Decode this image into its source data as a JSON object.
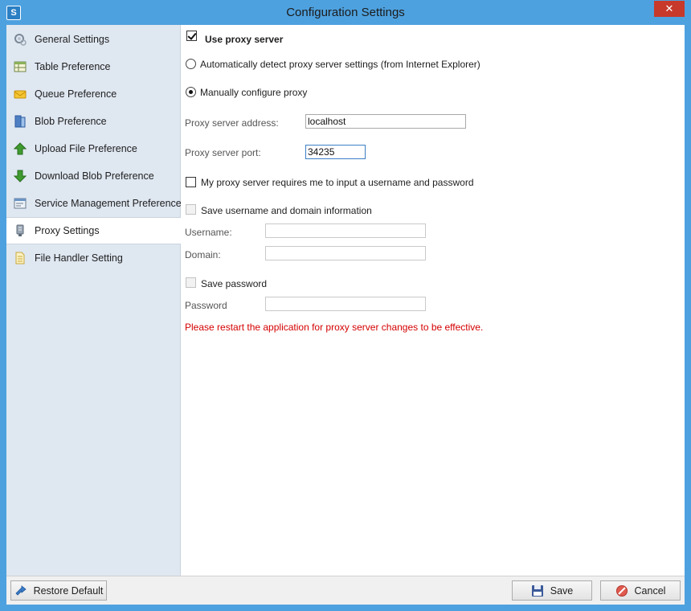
{
  "window": {
    "title": "Configuration Settings",
    "app_icon_text": "S",
    "close_glyph": "✕"
  },
  "sidebar": {
    "items": [
      {
        "label": "General Settings",
        "icon": "gear-icon"
      },
      {
        "label": "Table Preference",
        "icon": "table-icon"
      },
      {
        "label": "Queue Preference",
        "icon": "queue-icon"
      },
      {
        "label": "Blob Preference",
        "icon": "blob-icon"
      },
      {
        "label": "Upload File Preference",
        "icon": "upload-arrow-icon"
      },
      {
        "label": "Download Blob Preference",
        "icon": "download-arrow-icon"
      },
      {
        "label": "Service Management Preference",
        "icon": "service-window-icon"
      },
      {
        "label": "Proxy Settings",
        "icon": "proxy-server-icon",
        "selected": true
      },
      {
        "label": "File Handler Setting",
        "icon": "file-icon"
      }
    ]
  },
  "proxy": {
    "use_proxy_label": "Use proxy server",
    "use_proxy_checked": true,
    "auto_detect_label": "Automatically detect proxy server settings (from Internet Explorer)",
    "manual_label": "Manually configure proxy",
    "mode": "manual",
    "address_label": "Proxy server address:",
    "address_value": "localhost",
    "port_label": "Proxy server port:",
    "port_value": "34235",
    "requires_auth_label": "My proxy server requires me to input a username and password",
    "requires_auth_checked": false,
    "save_user_label": "Save username and domain information",
    "username_label": "Username:",
    "username_value": "",
    "domain_label": "Domain:",
    "domain_value": "",
    "save_password_label": "Save password",
    "password_label": "Password",
    "password_value": "",
    "restart_notice": "Please restart the application for proxy server changes to be effective."
  },
  "footer": {
    "restore_label": "Restore Default",
    "save_label": "Save",
    "cancel_label": "Cancel"
  },
  "colors": {
    "titlebar": "#4ea1df",
    "sidebar_bg": "#dfe7f1",
    "warning_text": "#d40000",
    "close_button": "#c7392b"
  }
}
